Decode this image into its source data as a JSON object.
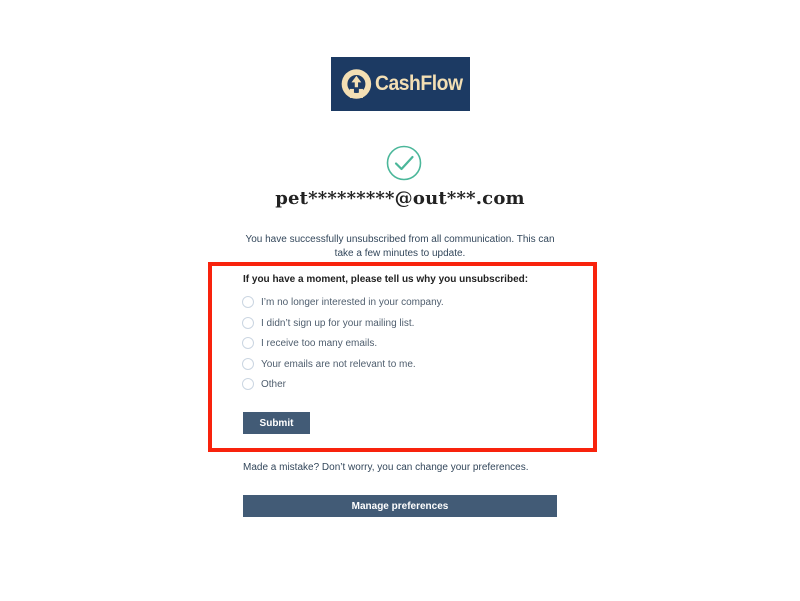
{
  "brand": {
    "name": "CashFlow",
    "logo_icon": "cashflow-logo-icon",
    "logo_bg": "#1c3a63",
    "logo_fg": "#f3dfb4"
  },
  "status": {
    "icon": "check-circle-icon",
    "color": "#4bb79a"
  },
  "email": "pet*********@out***.com",
  "success_message": "You have successfully unsubscribed from all communication. This can take a few minutes to update.",
  "survey": {
    "title": "If you have a moment, please tell us why you unsubscribed:",
    "options": [
      {
        "label": "I’m no longer interested in your company."
      },
      {
        "label": "I didn’t sign up for your mailing list."
      },
      {
        "label": "I receive too many emails."
      },
      {
        "label": "Your emails are not relevant to me."
      },
      {
        "label": "Other"
      }
    ],
    "submit_label": "Submit",
    "highlight_color": "#f8230d"
  },
  "preferences": {
    "message": "Made a mistake? Don’t worry, you can change your preferences.",
    "button_label": "Manage preferences"
  },
  "colors": {
    "button": "#425b76",
    "text": "#33475b"
  }
}
